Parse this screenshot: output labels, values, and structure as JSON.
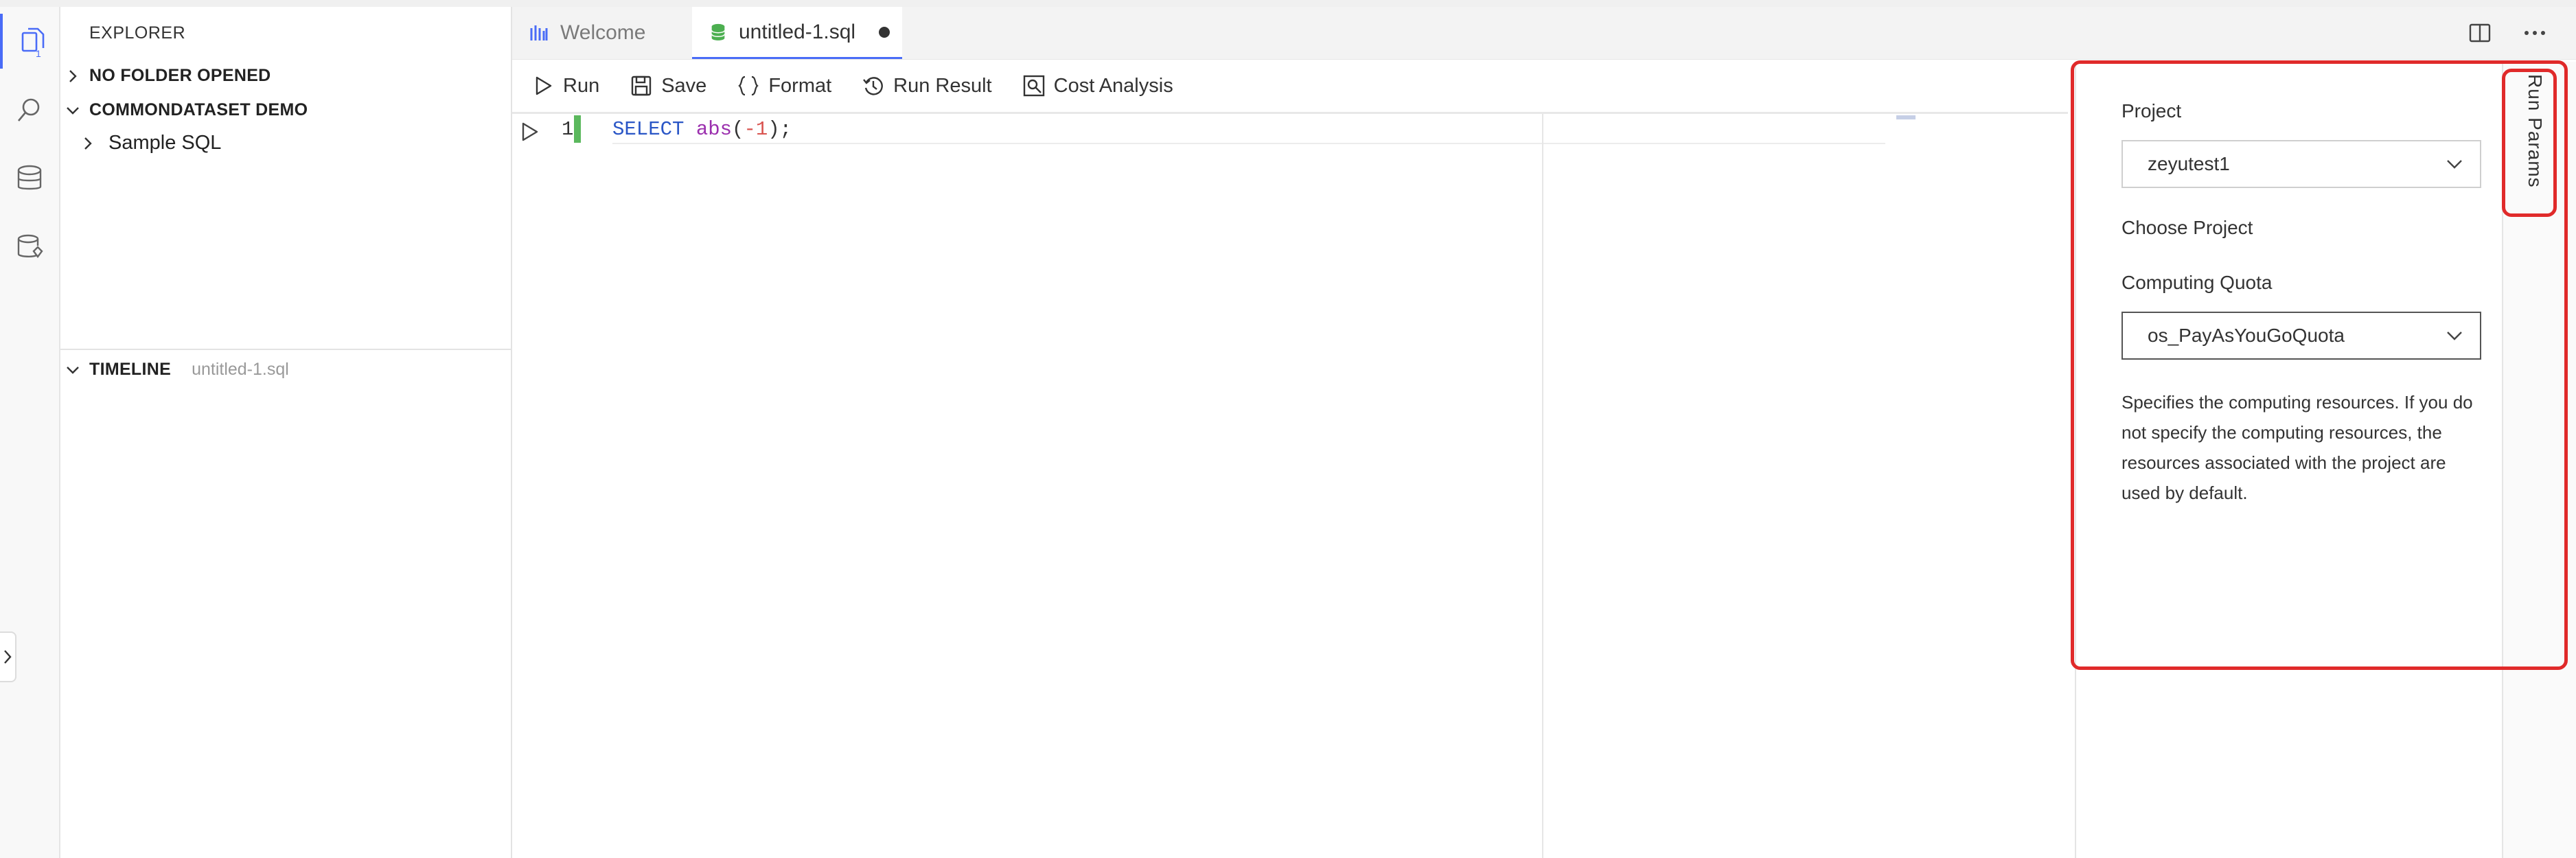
{
  "explorer": {
    "title": "EXPLORER",
    "no_folder": "NO FOLDER OPENED",
    "demo_section": "COMMONDATASET DEMO",
    "sample_sql": "Sample SQL",
    "timeline_label": "TIMELINE",
    "timeline_file": "untitled-1.sql"
  },
  "activity": {
    "explorer_badge": "1"
  },
  "tabs": [
    {
      "label": "Welcome",
      "icon": "logo-icon"
    },
    {
      "label": "untitled-1.sql",
      "icon": "database-icon",
      "modified": true
    }
  ],
  "toolbar": {
    "run": "Run",
    "save": "Save",
    "format": "Format",
    "run_result": "Run Result",
    "cost_analysis": "Cost Analysis"
  },
  "editor": {
    "line_number": "1",
    "code_keyword": "SELECT",
    "code_function": "abs",
    "code_open": "(",
    "code_number": "-1",
    "code_close": ");"
  },
  "run_params": {
    "tab_label": "Run Params",
    "project_label": "Project",
    "project_value": "zeyutest1",
    "project_help": "Choose Project",
    "quota_label": "Computing Quota",
    "quota_value": "os_PayAsYouGoQuota",
    "quota_help": "Specifies the computing resources. If you do not specify the computing resources, the resources associated with the project are used by default."
  },
  "colors": {
    "accent": "#4a6cf7",
    "highlight": "#e02a2a",
    "modified_marker": "#5bb85d"
  }
}
